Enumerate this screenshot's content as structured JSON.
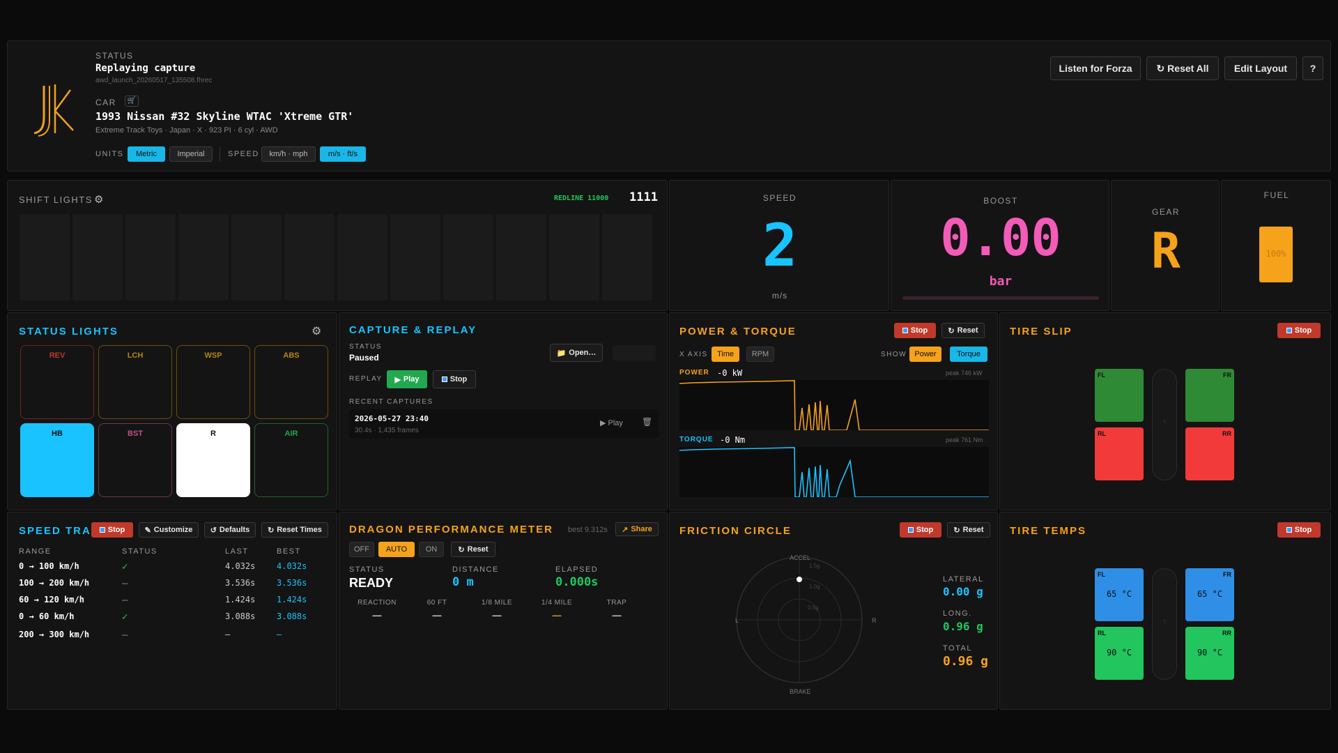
{
  "header": {
    "status_label": "STATUS",
    "status_value": "Replaying capture",
    "status_file": "awd_launch_20260517_135508.fhrec",
    "car_label": "CAR",
    "car_name": "1993 Nissan #32 Skyline WTAC 'Xtreme GTR'",
    "car_details": "Extreme Track Toys · Japan · X · 923 PI · 6 cyl · AWD",
    "units_label": "UNITS",
    "units_metric": "Metric",
    "units_imperial": "Imperial",
    "speed_label": "SPEED",
    "speed_kmh": "km/h · mph",
    "speed_ms": "m/s · ft/s",
    "btn_listen": "Listen for Forza",
    "btn_reset_all": "Reset All",
    "btn_edit_layout": "Edit Layout",
    "btn_help": "?"
  },
  "shift": {
    "title": "SHIFT LIGHTS",
    "redline_label": "REDLINE 11000",
    "rpm": "1111",
    "cells": 12
  },
  "speed": {
    "label": "SPEED",
    "value": "2",
    "unit": "m/s"
  },
  "boost": {
    "label": "BOOST",
    "value": "0.00",
    "unit": "bar"
  },
  "gear": {
    "label": "GEAR",
    "value": "R"
  },
  "fuel": {
    "label": "FUEL",
    "value": "100%",
    "level": 1.0
  },
  "status_lights": {
    "title": "STATUS LIGHTS",
    "lights": [
      {
        "label": "REV",
        "color": "#c0392b",
        "active": false
      },
      {
        "label": "LCH",
        "color": "#b8860b",
        "active": false
      },
      {
        "label": "WSP",
        "color": "#b8860b",
        "active": false
      },
      {
        "label": "ABS",
        "color": "#b8860b",
        "active": false
      },
      {
        "label": "HB",
        "color": "#19c3ff",
        "active": true
      },
      {
        "label": "BST",
        "color": "#c0508a",
        "active": false
      },
      {
        "label": "R",
        "color": "#ffffff",
        "active": true
      },
      {
        "label": "AIR",
        "color": "#22a84e",
        "active": false
      }
    ]
  },
  "capture": {
    "title": "CAPTURE & REPLAY",
    "status_label": "STATUS",
    "status_value": "Paused",
    "btn_open": "Open…",
    "replay_label": "REPLAY",
    "btn_play": "Play",
    "btn_stop": "Stop",
    "recent_label": "RECENT CAPTURES",
    "recent": [
      {
        "date": "2026-05-27 23:40",
        "meta": "30.4s · 1,435 frames",
        "play": "Play"
      }
    ]
  },
  "power": {
    "title": "POWER & TORQUE",
    "btn_stop": "Stop",
    "btn_reset": "Reset",
    "xaxis_label": "X AXIS",
    "x_time": "Time",
    "x_rpm": "RPM",
    "show_label": "SHOW",
    "show_power": "Power",
    "show_torque": "Torque",
    "power_label": "POWER",
    "power_value": "-0 kW",
    "power_peak": "peak 746 kW",
    "torque_label": "TORQUE",
    "torque_value": "-0 Nm",
    "torque_peak": "peak 761 Nm"
  },
  "tire_slip": {
    "title": "TIRE SLIP",
    "btn_stop": "Stop",
    "fl": "FL",
    "fr": "FR",
    "rl": "RL",
    "rr": "RR"
  },
  "speed_trap": {
    "title": "SPEED TRAP",
    "btn_stop": "Stop",
    "btn_customize": "Customize",
    "btn_defaults": "Defaults",
    "btn_reset_times": "Reset Times",
    "col_range": "RANGE",
    "col_status": "STATUS",
    "col_last": "LAST",
    "col_best": "BEST",
    "rows": [
      {
        "range": "0 → 100 km/h",
        "status": "✓",
        "last": "4.032s",
        "best": "4.032s"
      },
      {
        "range": "100 → 200 km/h",
        "status": "–",
        "last": "3.536s",
        "best": "3.536s"
      },
      {
        "range": "60 → 120 km/h",
        "status": "–",
        "last": "1.424s",
        "best": "1.424s"
      },
      {
        "range": "0 → 60 km/h",
        "status": "✓",
        "last": "3.088s",
        "best": "3.088s"
      },
      {
        "range": "200 → 300 km/h",
        "status": "–",
        "last": "–",
        "best": "–"
      }
    ]
  },
  "dragon": {
    "title": "DRAGON PERFORMANCE METER",
    "best": "best 9.312s",
    "btn_share": "Share",
    "btn_off": "OFF",
    "btn_auto": "AUTO",
    "btn_on": "ON",
    "btn_reset": "Reset",
    "status_label": "STATUS",
    "status_value": "READY",
    "distance_label": "DISTANCE",
    "distance_value": "0 m",
    "elapsed_label": "ELAPSED",
    "elapsed_value": "0.000s",
    "splits": [
      {
        "label": "REACTION",
        "value": "—"
      },
      {
        "label": "60 FT",
        "value": "—"
      },
      {
        "label": "1/8 MILE",
        "value": "—"
      },
      {
        "label": "1/4 MILE",
        "value": "—"
      },
      {
        "label": "TRAP",
        "value": "—"
      }
    ]
  },
  "friction": {
    "title": "FRICTION CIRCLE",
    "btn_stop": "Stop",
    "btn_reset": "Reset",
    "accel": "ACCEL",
    "brake": "BRAKE",
    "left": "L",
    "right": "R",
    "ring1": "1.5g",
    "ring2": "1.0g",
    "ring3": "0.5g",
    "lateral_label": "LATERAL",
    "lateral_value": "0.00 g",
    "long_label": "LONG.",
    "long_value": "0.96 g",
    "total_label": "TOTAL",
    "total_value": "0.96 g"
  },
  "tire_temps": {
    "title": "TIRE TEMPS",
    "btn_stop": "Stop",
    "fl": "FL",
    "fr": "FR",
    "rl": "RL",
    "rr": "RR",
    "fl_temp": "65 °C",
    "fr_temp": "65 °C",
    "rl_temp": "90 °C",
    "rr_temp": "90 °C"
  }
}
